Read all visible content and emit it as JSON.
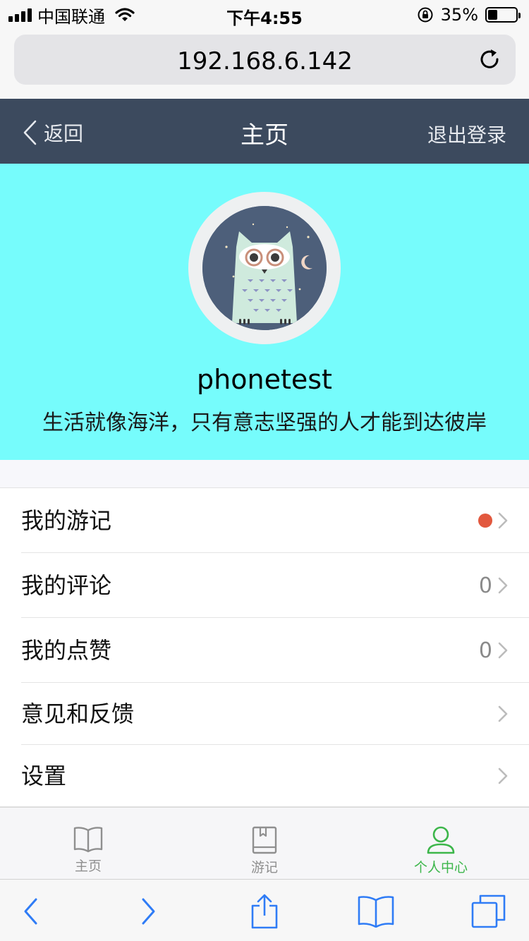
{
  "status_bar": {
    "carrier": "中国联通",
    "time": "下午4:55",
    "battery_percent": "35%",
    "battery_level": 0.35
  },
  "browser": {
    "url": "192.168.6.142"
  },
  "nav": {
    "back_label": "返回",
    "title": "主页",
    "logout_label": "退出登录"
  },
  "profile": {
    "username": "phonetest",
    "motto": "生活就像海洋，只有意志坚强的人才能到达彼岸",
    "background_color": "#76fcfc"
  },
  "menu": {
    "items": [
      {
        "label": "我的游记",
        "count": "",
        "has_dot": true
      },
      {
        "label": "我的评论",
        "count": "0",
        "has_dot": false
      },
      {
        "label": "我的点赞",
        "count": "0",
        "has_dot": false
      },
      {
        "label": "意见和反馈",
        "count": "",
        "has_dot": false
      },
      {
        "label": "设置",
        "count": "",
        "has_dot": false
      }
    ]
  },
  "tabbar": {
    "tabs": [
      {
        "label": "主页",
        "icon": "open-book-icon",
        "active": false
      },
      {
        "label": "游记",
        "icon": "bookmark-book-icon",
        "active": false
      },
      {
        "label": "个人中心",
        "icon": "person-icon",
        "active": true
      }
    ],
    "active_color": "#3cb64a"
  },
  "toolbar": {
    "icons": [
      "back-arrow-icon",
      "forward-arrow-icon",
      "share-icon",
      "bookmarks-icon",
      "tabs-icon"
    ],
    "accent_color": "#2f7cf6"
  }
}
